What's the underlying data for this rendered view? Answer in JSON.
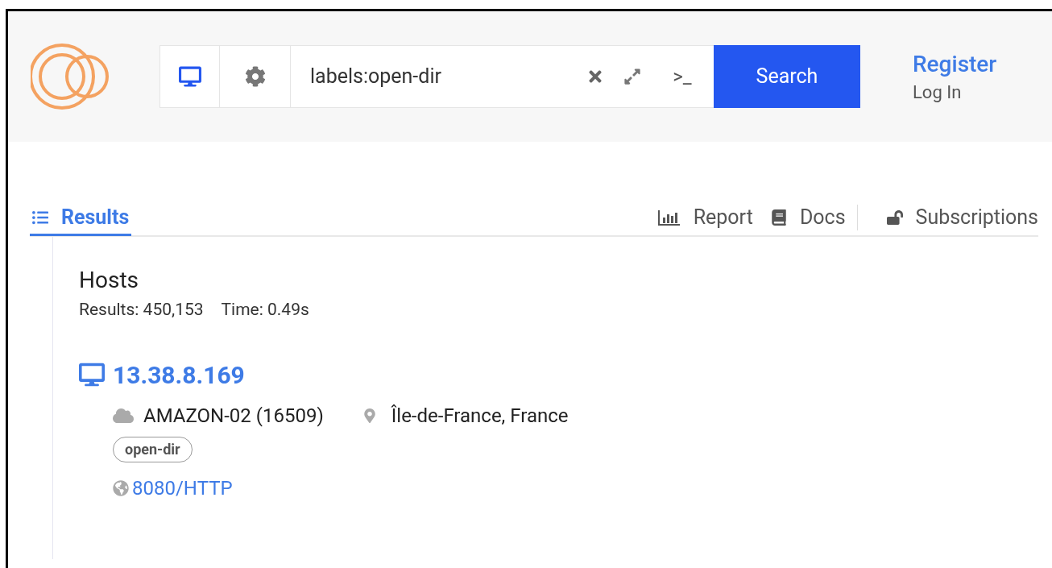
{
  "search": {
    "value": "labels:open-dir",
    "prompt_glyph": ">_",
    "button": "Search"
  },
  "account": {
    "register": "Register",
    "login": "Log In"
  },
  "tabs": [
    {
      "label": "Results",
      "selected": true
    },
    {
      "label": "Report",
      "selected": false
    },
    {
      "label": "Docs",
      "selected": false
    },
    {
      "label": "Subscriptions",
      "selected": false
    }
  ],
  "results": {
    "title": "Hosts",
    "count": "Results: 450,153",
    "time": "Time: 0.49s",
    "hosts": [
      {
        "ip": "13.38.8.169",
        "asn": "AMAZON-02 (16509)",
        "location": "Île-de-France, France",
        "labels": [
          "open-dir"
        ],
        "services": [
          "8080/HTTP"
        ]
      }
    ]
  }
}
